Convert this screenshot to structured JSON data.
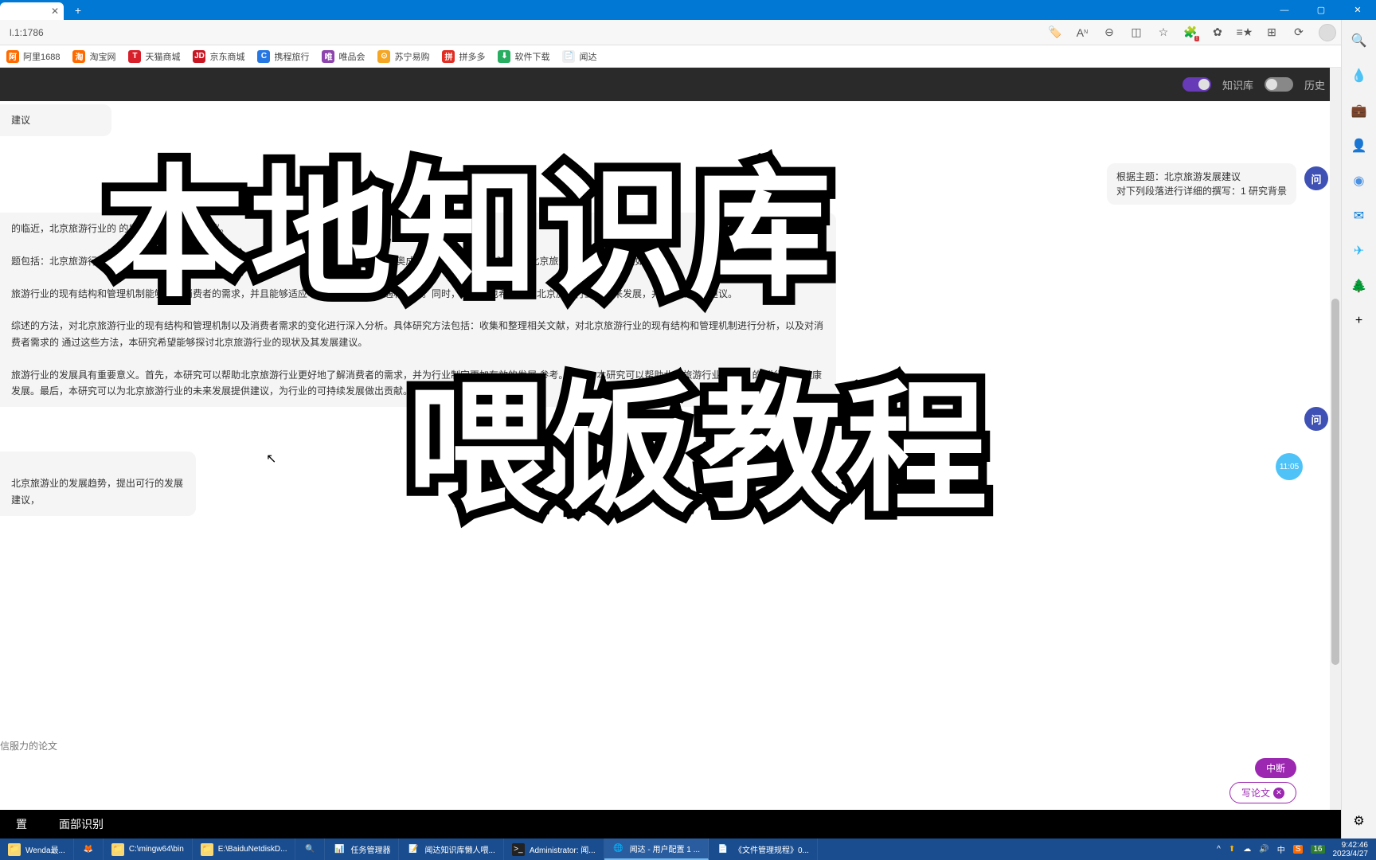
{
  "titlebar": {
    "tab_label": "",
    "new_tab": "+"
  },
  "window_controls": {
    "min": "—",
    "max": "▢",
    "close": "✕"
  },
  "address": {
    "url": "l.1:1786"
  },
  "addr_icons": [
    "🏷️",
    "Aᴺ",
    "⊖",
    "⧉",
    "☆",
    "🧩",
    "⚙",
    "≡",
    "🗂",
    "⟳"
  ],
  "bookmarks": [
    {
      "label": "阿里1688",
      "color": "#ff6a00",
      "glyph": "阿"
    },
    {
      "label": "淘宝网",
      "color": "#ff6a00",
      "glyph": "淘"
    },
    {
      "label": "天猫商城",
      "color": "#d8202b",
      "glyph": "T"
    },
    {
      "label": "京东商城",
      "color": "#c91623",
      "glyph": "JD"
    },
    {
      "label": "携程旅行",
      "color": "#2577e3",
      "glyph": "C"
    },
    {
      "label": "唯品会",
      "color": "#8e44ad",
      "glyph": "唯"
    },
    {
      "label": "苏宁易购",
      "color": "#f5a623",
      "glyph": "⊙"
    },
    {
      "label": "拼多多",
      "color": "#e02e24",
      "glyph": "拼"
    },
    {
      "label": "软件下载",
      "color": "#27ae60",
      "glyph": "⬇"
    },
    {
      "label": "闻达",
      "color": "#666",
      "glyph": "📄"
    }
  ],
  "header": {
    "toggle1_label": "知识库",
    "toggle2_label": "历史"
  },
  "chat": {
    "m1": "建议",
    "m2_line1": "根据主题：北京旅游发展建议",
    "m2_line2": "对下列段落进行详细的撰写：1 研究背景",
    "m3_p1": "的临近，北京旅游行业的                                                                                的发展                                战。因                                    发展建议。",
    "m3_p2": "题包括：北京旅游行业的现有结构和管理               如何满足消费者的需求？北京旅游行业如何适应申奥成功带来的机遇和挑战？以及北京旅游行业的未来发展如何？",
    "m3_p3": "旅游行业的现有结构和管理机制能够满足消费者的需求，并且能够适应申奥成功带来的机遇和挑战。同时，本研究也希望探讨北京旅游行业的未来发展，并提出相应的建议。",
    "m3_p4": "综述的方法，对北京旅游行业的现有结构和管理机制以及消费者需求的变化进行深入分析。具体研究方法包括：收集和整理相关文献，对北京旅游行业的现有结构和管理机制进行分析，以及对消费者需求的    通过这些方法，本研究希望能够探讨北京旅游行业的现状及其发展建议。",
    "m3_p5": "旅游行业的发展具有重要意义。首先，本研究可以帮助北京旅游行业更好地了解消费者的需求，并为行业制定更加有效的发展            参考。其次，本研究可以帮助北京旅游行业更好地                   的    进行业的健康发展。最后，本研究可以为北京旅游行业的未来发展提供建议，为行业的可持续发展做出贡献。",
    "m4": "北京旅游业的发展趋势，提出可行的发展建议，",
    "avatar_label": "问",
    "video_time": "11:05"
  },
  "input": {
    "placeholder": "信服力的论文"
  },
  "buttons": {
    "interrupt": "中断",
    "write": "写论文"
  },
  "footer": {
    "item1": "置",
    "item2": "面部识别"
  },
  "taskbar": [
    {
      "label": "Wenda最...",
      "icon": "📁",
      "color": "#f8d775"
    },
    {
      "label": "",
      "icon": "🦊",
      "color": "#ff7139"
    },
    {
      "label": "C:\\mingw64\\bin",
      "icon": "📁",
      "color": "#f8d775"
    },
    {
      "label": "E:\\BaiduNetdiskD...",
      "icon": "📁",
      "color": "#f8d775"
    },
    {
      "label": "",
      "icon": "🔍",
      "color": "#ff6a00"
    },
    {
      "label": "任务管理器",
      "icon": "📊",
      "color": "#4a90e2"
    },
    {
      "label": "闻达知识库懒人喂...",
      "icon": "📝",
      "color": "#4a90e2"
    },
    {
      "label": "Administrator: 闻...",
      "icon": "⬛",
      "color": "#222"
    },
    {
      "label": "闻达 - 用户配置 1 ...",
      "icon": "🌐",
      "color": "#0078d4",
      "active": true
    },
    {
      "label": "《文件管理规程》0...",
      "icon": "📄",
      "color": "#4a90e2"
    }
  ],
  "tray": {
    "icons": [
      "^",
      "⬆",
      "☁",
      "🔊",
      "中",
      "S",
      "16"
    ],
    "time": "9:42:46",
    "date": "2023/4/27"
  },
  "overlay": {
    "line1": "本地知识库",
    "line2": "喂饭教程"
  },
  "sidebar_icons": [
    "🔍",
    "💧",
    "💼",
    "👤",
    "🔵",
    "📧",
    "✈️",
    "🌲",
    "+"
  ]
}
